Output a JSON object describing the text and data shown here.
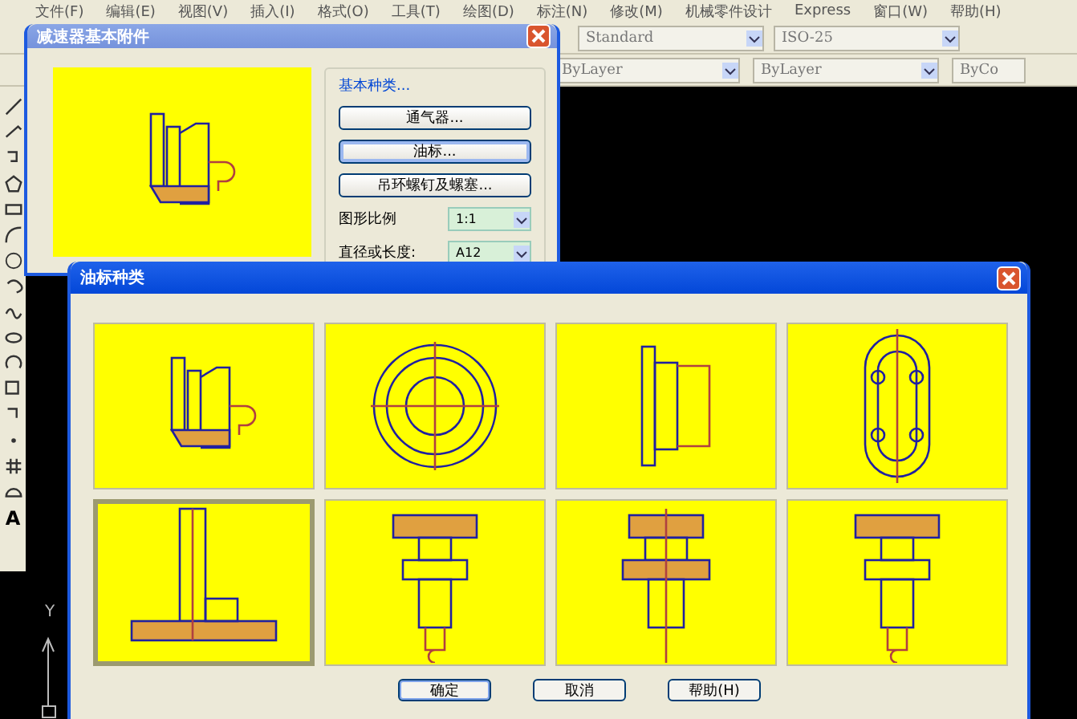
{
  "menu_bar": [
    "文件(F)",
    "编辑(E)",
    "视图(V)",
    "插入(I)",
    "格式(O)",
    "工具(T)",
    "绘图(D)",
    "标注(N)",
    "修改(M)",
    "机械零件设计",
    "Express",
    "窗口(W)",
    "帮助(H)"
  ],
  "toolbar": {
    "text_style": "Standard",
    "dim_style": "ISO-25",
    "linetype": "ByLayer",
    "lineweight": "ByLayer",
    "color_control": "ByCo"
  },
  "left_toolbar": {
    "text_tool": "A"
  },
  "ucs": {
    "axis": "Y"
  },
  "base_dialog": {
    "title": "减速器基本附件",
    "group": "基本种类...",
    "buttons": [
      {
        "label": "通气器...",
        "selected": false
      },
      {
        "label": "油标...",
        "selected": true
      },
      {
        "label": "吊环螺钉及螺塞...",
        "selected": false
      }
    ],
    "fields": [
      {
        "label": "图形比例",
        "value": "1:1"
      },
      {
        "label": "直径或长度:",
        "value": "A12"
      }
    ]
  },
  "type_dialog": {
    "title": "油标种类",
    "cells": [
      {
        "kind": "section",
        "selected": false
      },
      {
        "kind": "ring",
        "selected": false
      },
      {
        "kind": "side",
        "selected": false
      },
      {
        "kind": "oval",
        "selected": false
      },
      {
        "kind": "tube",
        "selected": true
      },
      {
        "kind": "knob",
        "selected": false
      },
      {
        "kind": "knob-section",
        "selected": false
      },
      {
        "kind": "knob",
        "selected": false
      }
    ],
    "buttons": [
      {
        "label": "确定",
        "default": true
      },
      {
        "label": "取消",
        "default": false
      },
      {
        "label": "帮助(H)",
        "default": false
      }
    ]
  }
}
